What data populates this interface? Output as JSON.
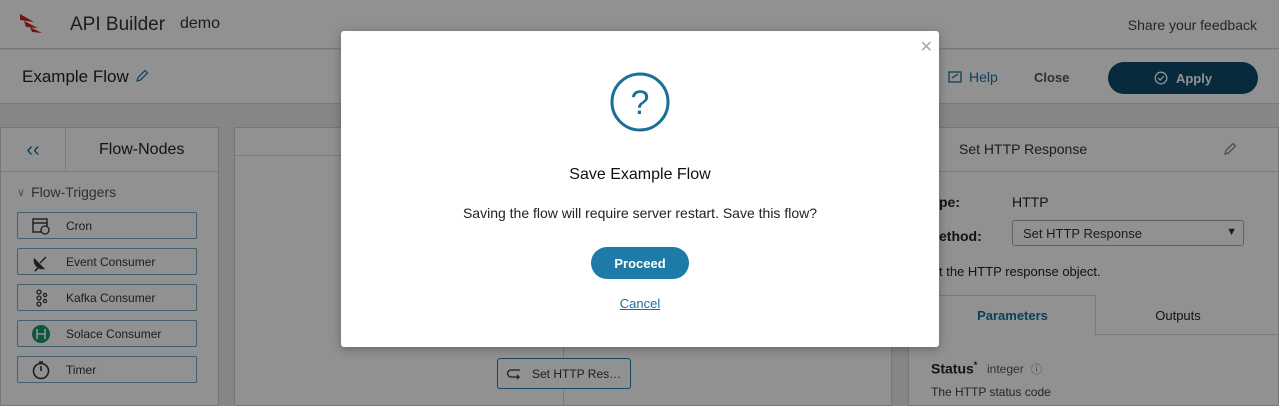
{
  "header": {
    "app_title": "API Builder",
    "env": "demo",
    "feedback": "Share your feedback"
  },
  "subheader": {
    "flow_title": "Example Flow",
    "help": "Help",
    "close": "Close",
    "apply": "Apply"
  },
  "left_panel": {
    "title": "Flow-Nodes",
    "section": "Flow-Triggers",
    "nodes": [
      {
        "label": "Cron",
        "icon": "calendar-clock-icon"
      },
      {
        "label": "Event Consumer",
        "icon": "satellite-dish-icon"
      },
      {
        "label": "Kafka Consumer",
        "icon": "kafka-icon"
      },
      {
        "label": "Solace Consumer",
        "icon": "solace-icon"
      },
      {
        "label": "Timer",
        "icon": "timer-icon"
      }
    ]
  },
  "canvas": {
    "node_label": "Set HTTP Res…"
  },
  "right_panel": {
    "title": "Set HTTP Response",
    "type_label": "pe:",
    "type_value": "HTTP",
    "method_label": "ethod:",
    "method_value": "Set HTTP Response",
    "description": "t the HTTP response object.",
    "tabs": [
      "Parameters",
      "Outputs"
    ],
    "param_name": "Status",
    "param_required": "*",
    "param_type": "integer",
    "param_desc": "The HTTP status code"
  },
  "modal": {
    "title": "Save Example Flow",
    "message": "Saving the flow will require server restart. Save this flow?",
    "proceed": "Proceed",
    "cancel": "Cancel"
  },
  "colors": {
    "primary": "#1e7aa6",
    "apply": "#0d4a6b",
    "link": "#1a6fa0"
  }
}
